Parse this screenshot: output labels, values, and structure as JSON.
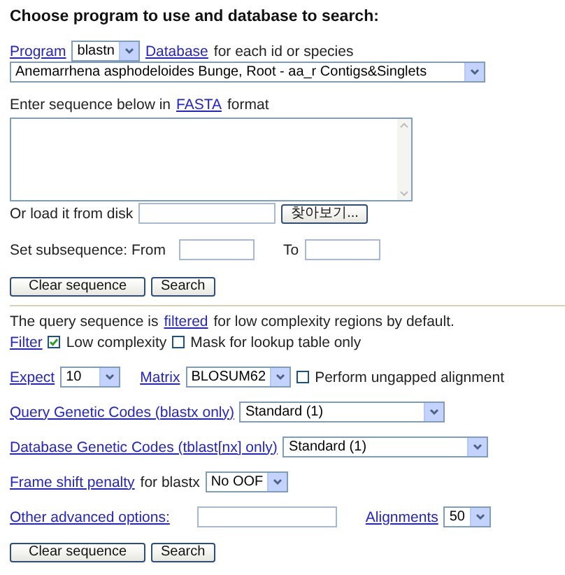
{
  "title": "Choose program to use and database to search:",
  "program": {
    "label": "Program",
    "value": "blastn"
  },
  "database": {
    "label": "Database",
    "suffix": "for each id or species",
    "value": "Anemarrhena asphodeloides Bunge, Root - aa_r Contigs&Singlets"
  },
  "sequence": {
    "before": "Enter sequence below in",
    "link": "FASTA",
    "after": "format"
  },
  "file": {
    "label": "Or load it from disk",
    "button": "찾아보기..."
  },
  "subsequence": {
    "from_label": "Set subsequence: From",
    "to_label": "To"
  },
  "buttons_top": [
    "Clear sequence",
    "Search"
  ],
  "filter_note": {
    "before": "The query sequence is",
    "link": "filtered",
    "after": "for low complexity regions by default."
  },
  "filter": {
    "label": "Filter",
    "options": [
      {
        "label": "Low complexity",
        "checked": true
      },
      {
        "label": "Mask for lookup table only",
        "checked": false
      }
    ]
  },
  "expect": {
    "label": "Expect",
    "value": "10"
  },
  "matrix": {
    "label": "Matrix",
    "value": "BLOSUM62"
  },
  "ungapped": {
    "label": "Perform ungapped alignment",
    "checked": false
  },
  "query_codes": {
    "label": "Query Genetic Codes (blastx only)",
    "value": "Standard (1)"
  },
  "db_codes": {
    "label": "Database Genetic Codes (tblast[nx] only)",
    "value": "Standard (1)"
  },
  "frame": {
    "label": "Frame shift penalty",
    "suffix": "for blastx",
    "value": "No OOF"
  },
  "other": {
    "label": "Other advanced options:"
  },
  "alignments": {
    "label": "Alignments",
    "value": "50"
  },
  "buttons_bottom": [
    "Clear sequence",
    "Search"
  ]
}
